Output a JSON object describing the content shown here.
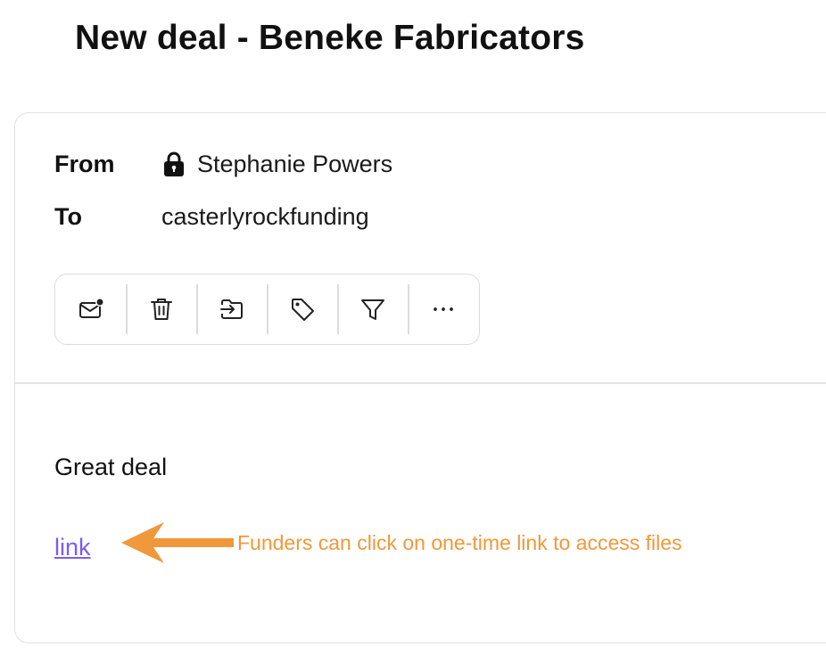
{
  "email": {
    "subject": "New deal - Beneke Fabricators",
    "from_label": "From",
    "from_value": "Stephanie Powers",
    "to_label": "To",
    "to_value": "casterlyrockfunding",
    "body_text": "Great deal",
    "link_text": "link"
  },
  "toolbar": {
    "buttons": [
      {
        "icon": "mark-unread-icon"
      },
      {
        "icon": "trash-icon"
      },
      {
        "icon": "move-to-folder-icon"
      },
      {
        "icon": "tag-icon"
      },
      {
        "icon": "filter-icon"
      },
      {
        "icon": "more-icon"
      }
    ]
  },
  "annotation": {
    "text": "Funders can click on one-time link to access files",
    "color": "#f0983a"
  },
  "colors": {
    "link": "#7b5cf0",
    "border": "#dcdcdc"
  }
}
